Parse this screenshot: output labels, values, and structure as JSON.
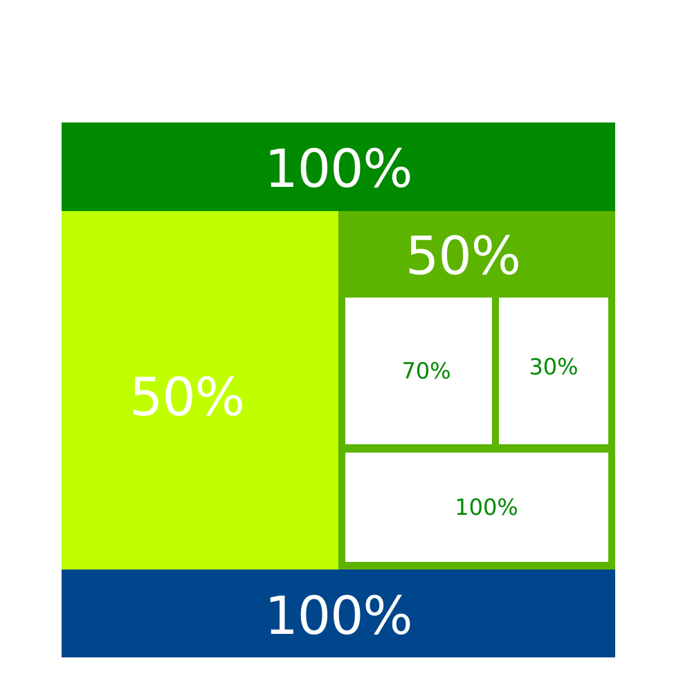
{
  "colors": {
    "header": "#008a00",
    "left_panel": "#bfff00",
    "right_panel": "#5cb300",
    "cell_bg": "#ffffff",
    "footer": "#00468c",
    "large_text": "#ffffff",
    "small_text": "#008a00"
  },
  "header": {
    "label": "100%"
  },
  "left_panel": {
    "label": "50%"
  },
  "right_panel": {
    "label": "50%",
    "cells": [
      {
        "label": "70%"
      },
      {
        "label": "30%"
      },
      {
        "label": "100%"
      }
    ]
  },
  "footer": {
    "label": "100%"
  }
}
